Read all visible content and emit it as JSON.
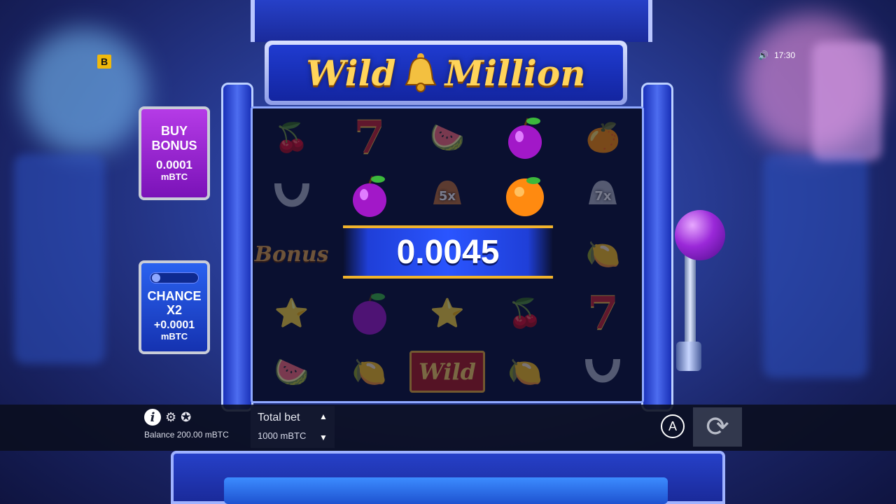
{
  "game": {
    "title_left": "Wild",
    "title_right": "Million",
    "clock": "17:30",
    "brand_letter": "B"
  },
  "buy_bonus": {
    "line1": "BUY",
    "line2": "BONUS",
    "price": "0.0001",
    "unit": "mBTC"
  },
  "chance": {
    "line1": "CHANCE",
    "line2": "X2",
    "price": "+0.0001",
    "unit": "mBTC"
  },
  "win": {
    "amount": "0.0045"
  },
  "reels": {
    "rows": [
      [
        "cherry",
        "seven",
        "watermelon",
        "plum",
        "orange"
      ],
      [
        "horseshoe",
        "plum",
        "bell-5x",
        "orange",
        "bell-7x"
      ],
      [
        "bonus",
        "",
        "",
        "",
        "lemon"
      ],
      [
        "star",
        "plum",
        "star",
        "cherry",
        "seven"
      ],
      [
        "watermelon",
        "lemon",
        "wild",
        "lemon",
        "horseshoe"
      ]
    ],
    "bell_5x_label": "5x",
    "bell_7x_label": "7x",
    "bonus_label": "Bonus",
    "wild_label": "Wild"
  },
  "bottom": {
    "balance": "Balance 200.00 mBTC",
    "total_bet_label": "Total bet",
    "total_bet_value": "1000 mBTC",
    "autoplay_label": "A"
  },
  "colors": {
    "accent_gold": "#f1b32c",
    "buy_bonus_bg": "#9a28d8",
    "chance_bg": "#2a62f0"
  }
}
